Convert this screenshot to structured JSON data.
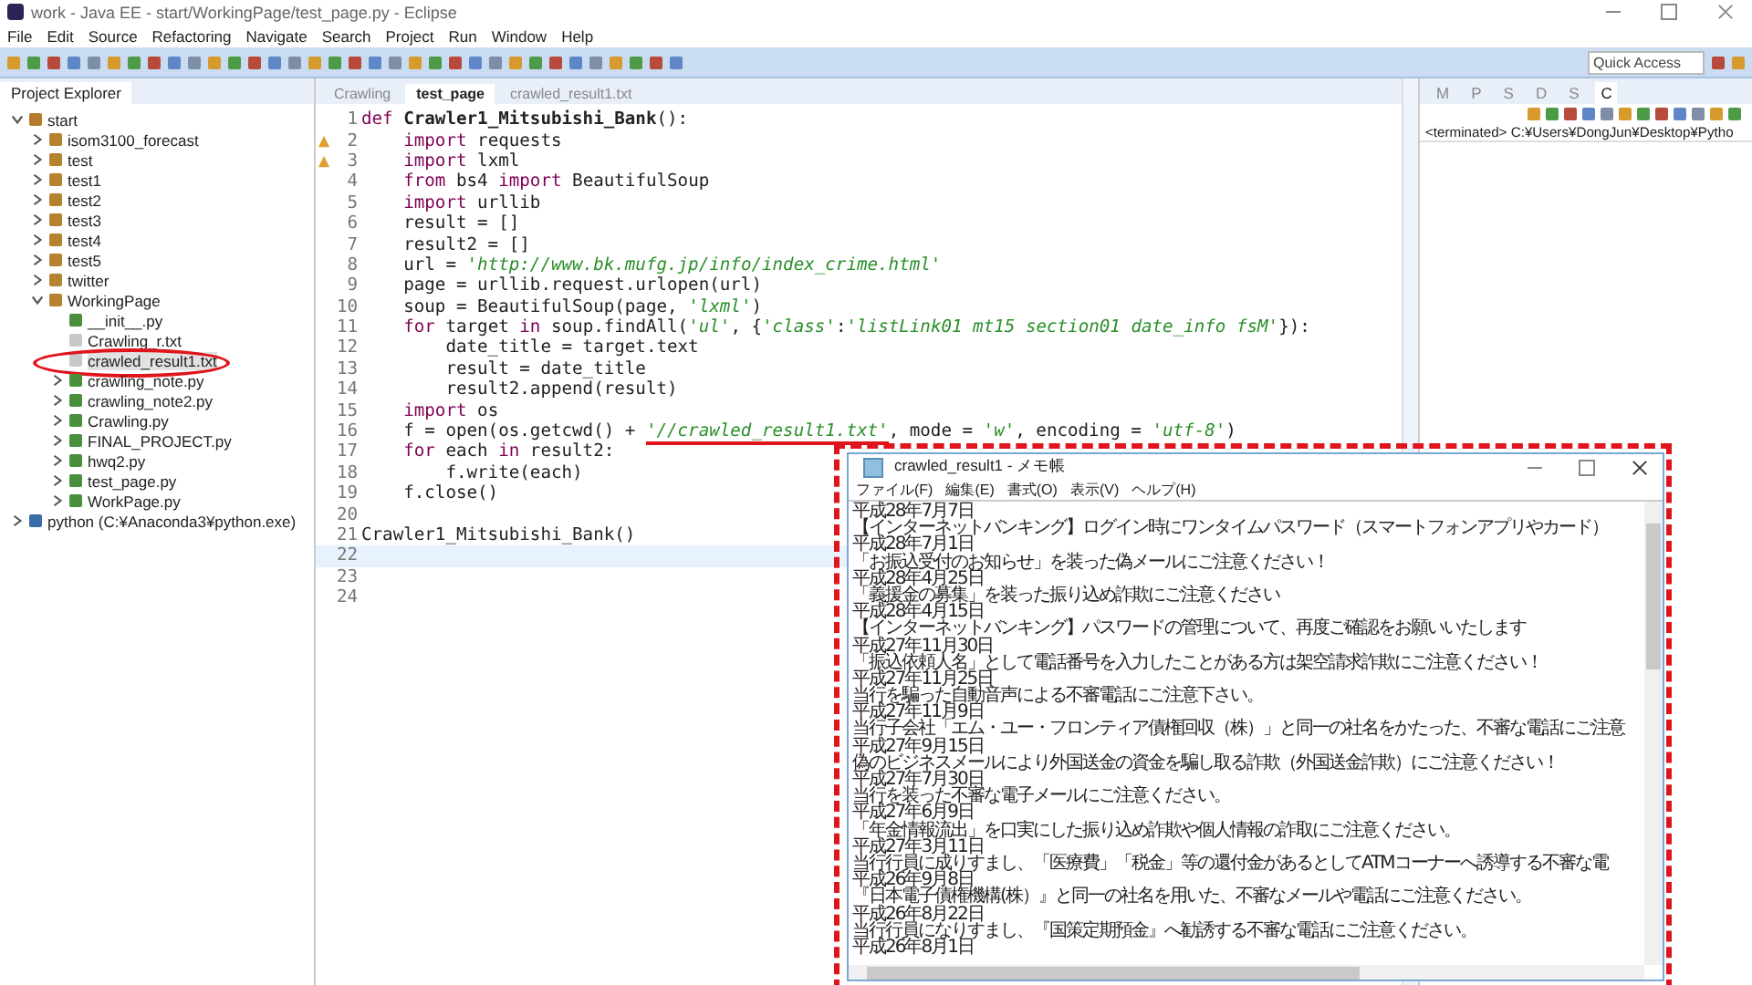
{
  "window": {
    "title": "work - Java EE - start/WorkingPage/test_page.py - Eclipse"
  },
  "menu": [
    "File",
    "Edit",
    "Source",
    "Refactoring",
    "Navigate",
    "Search",
    "Project",
    "Run",
    "Window",
    "Help"
  ],
  "quick_access": {
    "placeholder": "Quick Access"
  },
  "project_explorer": {
    "title": "Project Explorer",
    "tree": [
      {
        "label": "start",
        "kind": "project",
        "expanded": true,
        "selected": false,
        "children": [
          {
            "label": "isom3100_forecast",
            "kind": "package",
            "expanded": false,
            "selected": false
          },
          {
            "label": "test",
            "kind": "package",
            "expanded": false,
            "selected": false
          },
          {
            "label": "test1",
            "kind": "package",
            "expanded": false,
            "selected": false
          },
          {
            "label": "test2",
            "kind": "package",
            "expanded": false,
            "selected": false
          },
          {
            "label": "test3",
            "kind": "package",
            "expanded": false,
            "selected": false
          },
          {
            "label": "test4",
            "kind": "package",
            "expanded": false,
            "selected": false
          },
          {
            "label": "test5",
            "kind": "package",
            "expanded": false,
            "selected": false
          },
          {
            "label": "twitter",
            "kind": "package",
            "expanded": false,
            "selected": false
          },
          {
            "label": "WorkingPage",
            "kind": "package",
            "expanded": true,
            "selected": false,
            "children": [
              {
                "label": "__init__.py",
                "kind": "pyfile",
                "selected": false
              },
              {
                "label": "Crawling_r.txt",
                "kind": "txtfile",
                "selected": false
              },
              {
                "label": "crawled_result1.txt",
                "kind": "txtfile",
                "selected": true
              },
              {
                "label": "crawling_note.py",
                "kind": "pyfile",
                "expanded": false,
                "selected": false
              },
              {
                "label": "crawling_note2.py",
                "kind": "pyfile",
                "expanded": false,
                "selected": false
              },
              {
                "label": "Crawling.py",
                "kind": "pyfile",
                "expanded": false,
                "selected": false
              },
              {
                "label": "FINAL_PROJECT.py",
                "kind": "pyfile",
                "expanded": false,
                "selected": false
              },
              {
                "label": "hwq2.py",
                "kind": "pyfile",
                "expanded": false,
                "selected": false
              },
              {
                "label": "test_page.py",
                "kind": "pyfile",
                "expanded": false,
                "selected": false
              },
              {
                "label": "WorkPage.py",
                "kind": "pyfile",
                "expanded": false,
                "selected": false
              }
            ]
          }
        ]
      },
      {
        "label": "python  (C:¥Anaconda3¥python.exe)",
        "kind": "interpreter",
        "expanded": false,
        "selected": false
      }
    ]
  },
  "editor": {
    "tabs": [
      {
        "label": "Crawling",
        "selected": false
      },
      {
        "label": "test_page",
        "selected": true
      },
      {
        "label": "crawled_result1.txt",
        "selected": false
      }
    ],
    "lines": [
      {
        "number": "1",
        "warning": false,
        "current": false,
        "segments": [
          {
            "text": "def ",
            "kind": "kw"
          },
          {
            "text": "Crawler1_Mitsubishi_Bank",
            "kind": "fn"
          },
          {
            "text": "():",
            "kind": "plain"
          }
        ]
      },
      {
        "number": "2",
        "warning": true,
        "current": false,
        "segments": [
          {
            "text": "    import",
            "kind": "kw"
          },
          {
            "text": " requests",
            "kind": "plain"
          }
        ]
      },
      {
        "number": "3",
        "warning": true,
        "current": false,
        "segments": [
          {
            "text": "    import",
            "kind": "kw"
          },
          {
            "text": " lxml",
            "kind": "plain"
          }
        ]
      },
      {
        "number": "4",
        "warning": false,
        "current": false,
        "segments": [
          {
            "text": "    from",
            "kind": "kw"
          },
          {
            "text": " bs4 ",
            "kind": "plain"
          },
          {
            "text": "import",
            "kind": "kw"
          },
          {
            "text": " BeautifulSoup",
            "kind": "plain"
          }
        ]
      },
      {
        "number": "5",
        "warning": false,
        "current": false,
        "segments": [
          {
            "text": "    import",
            "kind": "kw"
          },
          {
            "text": " urllib",
            "kind": "plain"
          }
        ]
      },
      {
        "number": "6",
        "warning": false,
        "current": false,
        "segments": [
          {
            "text": "    result = []",
            "kind": "plain"
          }
        ]
      },
      {
        "number": "7",
        "warning": false,
        "current": false,
        "segments": [
          {
            "text": "    result2 = []",
            "kind": "plain"
          }
        ]
      },
      {
        "number": "8",
        "warning": false,
        "current": false,
        "segments": [
          {
            "text": "    url = ",
            "kind": "plain"
          },
          {
            "text": "'http://www.bk.mufg.jp/info/index_crime.html'",
            "kind": "str"
          }
        ]
      },
      {
        "number": "9",
        "warning": false,
        "current": false,
        "segments": [
          {
            "text": "    page = urllib.request.urlopen(url)",
            "kind": "plain"
          }
        ]
      },
      {
        "number": "10",
        "warning": false,
        "current": false,
        "segments": [
          {
            "text": "    soup = BeautifulSoup(page, ",
            "kind": "plain"
          },
          {
            "text": "'lxml'",
            "kind": "str"
          },
          {
            "text": ")",
            "kind": "plain"
          }
        ]
      },
      {
        "number": "11",
        "warning": false,
        "current": false,
        "segments": [
          {
            "text": "    for",
            "kind": "kw"
          },
          {
            "text": " target ",
            "kind": "plain"
          },
          {
            "text": "in",
            "kind": "kw"
          },
          {
            "text": " soup.findAll(",
            "kind": "plain"
          },
          {
            "text": "'ul'",
            "kind": "str"
          },
          {
            "text": ", {",
            "kind": "plain"
          },
          {
            "text": "'class'",
            "kind": "str"
          },
          {
            "text": ":",
            "kind": "plain"
          },
          {
            "text": "'listLink01 mt15 section01 date_info fsM'",
            "kind": "str"
          },
          {
            "text": "}):",
            "kind": "plain"
          }
        ]
      },
      {
        "number": "12",
        "warning": false,
        "current": false,
        "segments": [
          {
            "text": "        date_title = target.text",
            "kind": "plain"
          }
        ]
      },
      {
        "number": "13",
        "warning": false,
        "current": false,
        "segments": [
          {
            "text": "        result = date_title",
            "kind": "plain"
          }
        ]
      },
      {
        "number": "14",
        "warning": false,
        "current": false,
        "segments": [
          {
            "text": "        result2.append(result)",
            "kind": "plain"
          }
        ]
      },
      {
        "number": "15",
        "warning": false,
        "current": false,
        "segments": [
          {
            "text": "    import",
            "kind": "kw"
          },
          {
            "text": " os",
            "kind": "plain"
          }
        ]
      },
      {
        "number": "16",
        "warning": false,
        "current": false,
        "segments": [
          {
            "text": "    f = open(os.getcwd() + ",
            "kind": "plain"
          },
          {
            "text": "'//crawled_result1.txt'",
            "kind": "str",
            "underlined": true
          },
          {
            "text": ", mode = ",
            "kind": "plain"
          },
          {
            "text": "'w'",
            "kind": "str"
          },
          {
            "text": ", encoding = ",
            "kind": "plain"
          },
          {
            "text": "'utf-8'",
            "kind": "str"
          },
          {
            "text": ")",
            "kind": "plain"
          }
        ]
      },
      {
        "number": "17",
        "warning": false,
        "current": false,
        "segments": [
          {
            "text": "    for",
            "kind": "kw"
          },
          {
            "text": " each ",
            "kind": "plain"
          },
          {
            "text": "in",
            "kind": "kw"
          },
          {
            "text": " result2:",
            "kind": "plain"
          }
        ]
      },
      {
        "number": "18",
        "warning": false,
        "current": false,
        "segments": [
          {
            "text": "        f.write(each)",
            "kind": "plain"
          }
        ]
      },
      {
        "number": "19",
        "warning": false,
        "current": false,
        "segments": [
          {
            "text": "    f.close()",
            "kind": "plain"
          }
        ]
      },
      {
        "number": "20",
        "warning": false,
        "current": false
      },
      {
        "number": "21",
        "warning": false,
        "current": false,
        "segments": [
          {
            "text": "Crawler1_Mitsubishi_Bank()",
            "kind": "plain"
          }
        ]
      },
      {
        "number": "22",
        "warning": false,
        "current": true
      },
      {
        "number": "23",
        "warning": false,
        "current": false
      },
      {
        "number": "24",
        "warning": false,
        "current": false
      }
    ]
  },
  "console": {
    "tabs": [
      {
        "label": "M",
        "selected": false
      },
      {
        "label": "P",
        "selected": false
      },
      {
        "label": "S",
        "selected": false
      },
      {
        "label": "D",
        "selected": false
      },
      {
        "label": "S",
        "selected": false
      },
      {
        "label": "C",
        "selected": true
      }
    ],
    "text": "<terminated> C:¥Users¥DongJun¥Desktop¥Pytho"
  },
  "notepad": {
    "title": "crawled_result1 - メモ帳",
    "menu": [
      "ファイル(F)",
      "編集(E)",
      "書式(O)",
      "表示(V)",
      "ヘルプ(H)"
    ],
    "lines": [
      "平成28年7月7日",
      "【インターネットバンキング】ログイン時にワンタイムパスワード（スマートフォンアプリやカード）",
      "平成28年7月1日",
      "「お振込受付のお知らせ」を装った偽メールにご注意ください！",
      "平成28年4月25日",
      "「義援金の募集」を装った振り込め詐欺にご注意ください",
      "平成28年4月15日",
      "【インターネットバンキング】パスワードの管理について、再度ご確認をお願いいたします",
      "平成27年11月30日",
      "「振込依頼人名」として電話番号を入力したことがある方は架空請求詐欺にご注意ください！",
      "平成27年11月25日",
      "当行を騙った自動音声による不審電話にご注意下さい。",
      "平成27年11月9日",
      "当行子会社「エム・ユー・フロンティア債権回収（株）」と同一の社名をかたった、不審な電話にご注意",
      "平成27年9月15日",
      "偽のビジネスメールにより外国送金の資金を騙し取る詐欺（外国送金詐欺）にご注意ください！",
      "平成27年7月30日",
      "当行を装った不審な電子メールにご注意ください。",
      "平成27年6月9日",
      "「年金情報流出」を口実にした振り込め詐欺や個人情報の詐取にご注意ください。",
      "平成27年3月11日",
      "当行行員に成りすまし、「医療費」「税金」等の還付金があるとしてATMコーナーへ誘導する不審な電",
      "平成26年9月8日",
      "『日本電子債権機構(株）』と同一の社名を用いた、不審なメールや電話にご注意ください。",
      "平成26年8月22日",
      "当行行員になりすまし、『国策定期預金』へ勧誘する不審な電話にご注意ください。",
      "平成26年8月1日"
    ]
  }
}
